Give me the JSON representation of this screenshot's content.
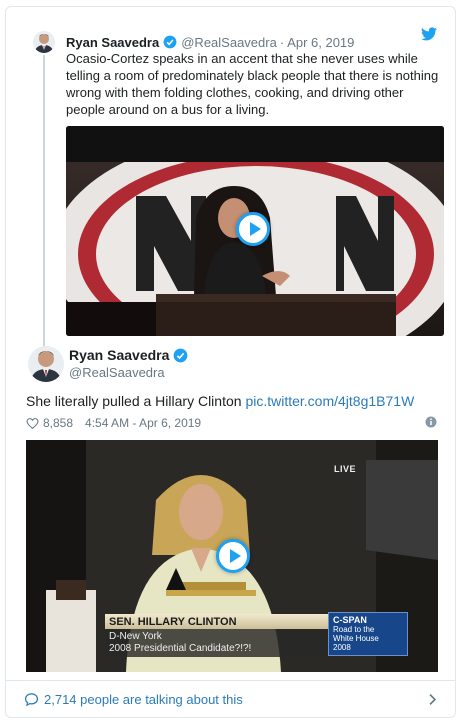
{
  "quoted_tweet": {
    "author_name": "Ryan Saavedra",
    "author_handle": "@RealSaavedra",
    "separator": "·",
    "date": "Apr 6, 2019",
    "text": "Ocasio-Cortez speaks in an accent that she never uses while telling a room of predominately black people that there is nothing wrong with them folding clothes, cooking, and driving other people around on a bus for a living.",
    "media_kind": "video"
  },
  "main_tweet": {
    "author_name": "Ryan Saavedra",
    "author_handle": "@RealSaavedra",
    "text": "She literally pulled a Hillary Clinton ",
    "link_text": "pic.twitter.com/4jt8g1B71W",
    "like_count": "8,858",
    "timestamp": "4:54 AM - Apr 6, 2019",
    "media_kind": "video",
    "video_overlay": {
      "live_label": "LIVE",
      "caption_name": "SEN. HILLARY CLINTON",
      "caption_line1": "D-New York",
      "caption_line2": "2008 Presidential Candidate?!?!",
      "network": "C-SPAN",
      "network_line1": "Road to the",
      "network_line2": "White House",
      "network_line3": "2008"
    }
  },
  "footer": {
    "conversation_text": "2,714 people are talking about this"
  },
  "colors": {
    "link": "#2b7bb9",
    "twitter_blue": "#1da1f2",
    "muted": "#697882",
    "border": "#e1e8ed"
  },
  "icons": [
    "verified-badge-icon",
    "twitter-bird-icon",
    "heart-icon",
    "info-icon",
    "play-icon",
    "speech-bubble-icon",
    "chevron-right-icon"
  ]
}
